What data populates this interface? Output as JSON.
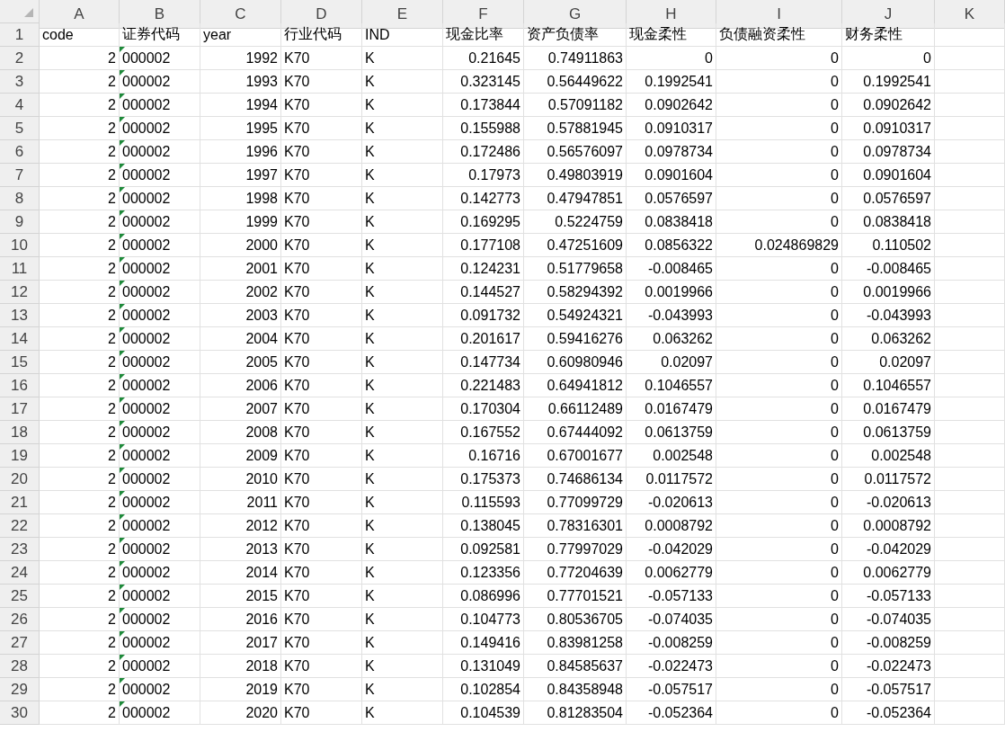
{
  "columns": [
    {
      "letter": "A",
      "kind": "number"
    },
    {
      "letter": "B",
      "kind": "number_as_text"
    },
    {
      "letter": "C",
      "kind": "number"
    },
    {
      "letter": "D",
      "kind": "text"
    },
    {
      "letter": "E",
      "kind": "text"
    },
    {
      "letter": "F",
      "kind": "number"
    },
    {
      "letter": "G",
      "kind": "number"
    },
    {
      "letter": "H",
      "kind": "number"
    },
    {
      "letter": "I",
      "kind": "number"
    },
    {
      "letter": "J",
      "kind": "number"
    },
    {
      "letter": "K",
      "kind": "text"
    }
  ],
  "header_row": {
    "number": "1",
    "cells": [
      "code",
      "证券代码",
      "year",
      "行业代码",
      "IND",
      "现金比率",
      "资产负债率",
      "现金柔性",
      "负债融资柔性",
      "财务柔性"
    ]
  },
  "rows": [
    {
      "number": "2",
      "cells": [
        "2",
        "000002",
        "1992",
        "K70",
        "K",
        "0.21645",
        "0.74911863",
        "0",
        "0",
        "0"
      ]
    },
    {
      "number": "3",
      "cells": [
        "2",
        "000002",
        "1993",
        "K70",
        "K",
        "0.323145",
        "0.56449622",
        "0.1992541",
        "0",
        "0.1992541"
      ]
    },
    {
      "number": "4",
      "cells": [
        "2",
        "000002",
        "1994",
        "K70",
        "K",
        "0.173844",
        "0.57091182",
        "0.0902642",
        "0",
        "0.0902642"
      ]
    },
    {
      "number": "5",
      "cells": [
        "2",
        "000002",
        "1995",
        "K70",
        "K",
        "0.155988",
        "0.57881945",
        "0.0910317",
        "0",
        "0.0910317"
      ]
    },
    {
      "number": "6",
      "cells": [
        "2",
        "000002",
        "1996",
        "K70",
        "K",
        "0.172486",
        "0.56576097",
        "0.0978734",
        "0",
        "0.0978734"
      ]
    },
    {
      "number": "7",
      "cells": [
        "2",
        "000002",
        "1997",
        "K70",
        "K",
        "0.17973",
        "0.49803919",
        "0.0901604",
        "0",
        "0.0901604"
      ]
    },
    {
      "number": "8",
      "cells": [
        "2",
        "000002",
        "1998",
        "K70",
        "K",
        "0.142773",
        "0.47947851",
        "0.0576597",
        "0",
        "0.0576597"
      ]
    },
    {
      "number": "9",
      "cells": [
        "2",
        "000002",
        "1999",
        "K70",
        "K",
        "0.169295",
        "0.5224759",
        "0.0838418",
        "0",
        "0.0838418"
      ]
    },
    {
      "number": "10",
      "cells": [
        "2",
        "000002",
        "2000",
        "K70",
        "K",
        "0.177108",
        "0.47251609",
        "0.0856322",
        "0.024869829",
        "0.110502"
      ]
    },
    {
      "number": "11",
      "cells": [
        "2",
        "000002",
        "2001",
        "K70",
        "K",
        "0.124231",
        "0.51779658",
        "-0.008465",
        "0",
        "-0.008465"
      ]
    },
    {
      "number": "12",
      "cells": [
        "2",
        "000002",
        "2002",
        "K70",
        "K",
        "0.144527",
        "0.58294392",
        "0.0019966",
        "0",
        "0.0019966"
      ]
    },
    {
      "number": "13",
      "cells": [
        "2",
        "000002",
        "2003",
        "K70",
        "K",
        "0.091732",
        "0.54924321",
        "-0.043993",
        "0",
        "-0.043993"
      ]
    },
    {
      "number": "14",
      "cells": [
        "2",
        "000002",
        "2004",
        "K70",
        "K",
        "0.201617",
        "0.59416276",
        "0.063262",
        "0",
        "0.063262"
      ]
    },
    {
      "number": "15",
      "cells": [
        "2",
        "000002",
        "2005",
        "K70",
        "K",
        "0.147734",
        "0.60980946",
        "0.02097",
        "0",
        "0.02097"
      ]
    },
    {
      "number": "16",
      "cells": [
        "2",
        "000002",
        "2006",
        "K70",
        "K",
        "0.221483",
        "0.64941812",
        "0.1046557",
        "0",
        "0.1046557"
      ]
    },
    {
      "number": "17",
      "cells": [
        "2",
        "000002",
        "2007",
        "K70",
        "K",
        "0.170304",
        "0.66112489",
        "0.0167479",
        "0",
        "0.0167479"
      ]
    },
    {
      "number": "18",
      "cells": [
        "2",
        "000002",
        "2008",
        "K70",
        "K",
        "0.167552",
        "0.67444092",
        "0.0613759",
        "0",
        "0.0613759"
      ]
    },
    {
      "number": "19",
      "cells": [
        "2",
        "000002",
        "2009",
        "K70",
        "K",
        "0.16716",
        "0.67001677",
        "0.002548",
        "0",
        "0.002548"
      ]
    },
    {
      "number": "20",
      "cells": [
        "2",
        "000002",
        "2010",
        "K70",
        "K",
        "0.175373",
        "0.74686134",
        "0.0117572",
        "0",
        "0.0117572"
      ]
    },
    {
      "number": "21",
      "cells": [
        "2",
        "000002",
        "2011",
        "K70",
        "K",
        "0.115593",
        "0.77099729",
        "-0.020613",
        "0",
        "-0.020613"
      ]
    },
    {
      "number": "22",
      "cells": [
        "2",
        "000002",
        "2012",
        "K70",
        "K",
        "0.138045",
        "0.78316301",
        "0.0008792",
        "0",
        "0.0008792"
      ]
    },
    {
      "number": "23",
      "cells": [
        "2",
        "000002",
        "2013",
        "K70",
        "K",
        "0.092581",
        "0.77997029",
        "-0.042029",
        "0",
        "-0.042029"
      ]
    },
    {
      "number": "24",
      "cells": [
        "2",
        "000002",
        "2014",
        "K70",
        "K",
        "0.123356",
        "0.77204639",
        "0.0062779",
        "0",
        "0.0062779"
      ]
    },
    {
      "number": "25",
      "cells": [
        "2",
        "000002",
        "2015",
        "K70",
        "K",
        "0.086996",
        "0.77701521",
        "-0.057133",
        "0",
        "-0.057133"
      ]
    },
    {
      "number": "26",
      "cells": [
        "2",
        "000002",
        "2016",
        "K70",
        "K",
        "0.104773",
        "0.80536705",
        "-0.074035",
        "0",
        "-0.074035"
      ]
    },
    {
      "number": "27",
      "cells": [
        "2",
        "000002",
        "2017",
        "K70",
        "K",
        "0.149416",
        "0.83981258",
        "-0.008259",
        "0",
        "-0.008259"
      ]
    },
    {
      "number": "28",
      "cells": [
        "2",
        "000002",
        "2018",
        "K70",
        "K",
        "0.131049",
        "0.84585637",
        "-0.022473",
        "0",
        "-0.022473"
      ]
    },
    {
      "number": "29",
      "cells": [
        "2",
        "000002",
        "2019",
        "K70",
        "K",
        "0.102854",
        "0.84358948",
        "-0.057517",
        "0",
        "-0.057517"
      ]
    },
    {
      "number": "30",
      "cells": [
        "2",
        "000002",
        "2020",
        "K70",
        "K",
        "0.104539",
        "0.81283504",
        "-0.052364",
        "0",
        "-0.052364"
      ]
    }
  ]
}
